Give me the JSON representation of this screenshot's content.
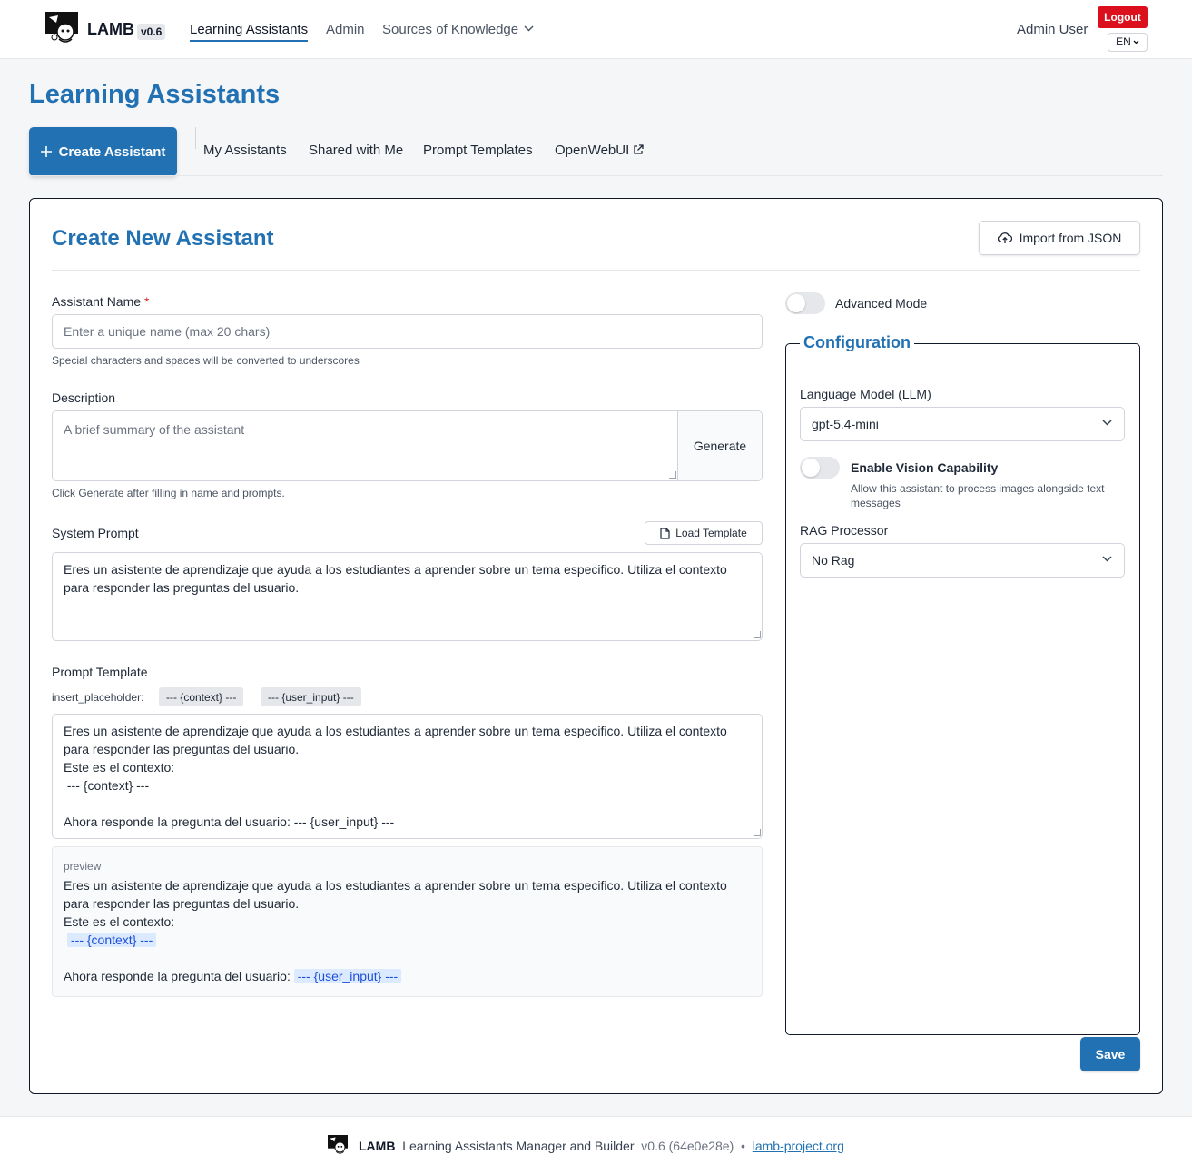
{
  "header": {
    "brand": "LAMB",
    "version": "v0.6",
    "nav": [
      {
        "label": "Learning Assistants",
        "active": true
      },
      {
        "label": "Admin",
        "active": false
      },
      {
        "label": "Sources of Knowledge",
        "active": false
      }
    ],
    "user_name": "Admin User",
    "logout_label": "Logout",
    "language": "EN"
  },
  "page": {
    "title": "Learning Assistants",
    "create_button": "Create Assistant",
    "tabs": [
      "My Assistants",
      "Shared with Me",
      "Prompt Templates",
      "OpenWebUI"
    ]
  },
  "form": {
    "title": "Create New Assistant",
    "import_button": "Import from JSON",
    "name": {
      "label": "Assistant Name",
      "required_mark": "*",
      "placeholder": "Enter a unique name (max 20 chars)",
      "value": "",
      "hint": "Special characters and spaces will be converted to underscores"
    },
    "description": {
      "label": "Description",
      "placeholder": "A brief summary of the assistant",
      "value": "",
      "generate_button": "Generate",
      "hint": "Click Generate after filling in name and prompts."
    },
    "system_prompt": {
      "label": "System Prompt",
      "load_template_button": "Load Template",
      "value": "Eres un asistente de aprendizaje que ayuda a los estudiantes a aprender sobre un tema especifico. Utiliza el contexto\npara responder las preguntas del usuario."
    },
    "prompt_template": {
      "label": "Prompt Template",
      "placeholder_label": "insert_placeholder:",
      "placeholders": [
        "--- {context} ---",
        "--- {user_input} ---"
      ],
      "value": "Eres un asistente de aprendizaje que ayuda a los estudiantes a aprender sobre un tema especifico. Utiliza el contexto\npara responder las preguntas del usuario.\nEste es el contexto:\n --- {context} ---\n\nAhora responde la pregunta del usuario: --- {user_input} ---"
    },
    "preview": {
      "label": "preview",
      "line1": "Eres un asistente de aprendizaje que ayuda a los estudiantes a aprender sobre un tema especifico. Utiliza el contexto",
      "line2": "para responder las preguntas del usuario.",
      "line3": "Este es el contexto:",
      "context_token": "--- {context} ---",
      "line5_prefix": "Ahora responde la pregunta del usuario:",
      "user_input_token": "--- {user_input} ---"
    },
    "advanced_mode": {
      "label": "Advanced Mode",
      "enabled": false
    },
    "configuration": {
      "legend": "Configuration",
      "llm_label": "Language Model (LLM)",
      "llm_value": "gpt-5.4-mini",
      "vision": {
        "label": "Enable Vision Capability",
        "enabled": false,
        "hint": "Allow this assistant to process images alongside text messages"
      },
      "rag_label": "RAG Processor",
      "rag_value": "No Rag"
    },
    "save_button": "Save"
  },
  "footer": {
    "brand": "LAMB",
    "tagline": "Learning Assistants Manager and Builder",
    "version": "v0.6 (64e0e28e)",
    "separator": "•",
    "link": "lamb-project.org"
  },
  "colors": {
    "primary": "#2271b3",
    "logout": "#dc0f1c",
    "highlight_bg": "#dbeafe",
    "highlight_text": "#1d4ed8"
  },
  "icons": [
    "lamb-logo-icon",
    "chevron-down-icon",
    "plus-icon",
    "external-link-icon",
    "cloud-upload-icon",
    "file-icon"
  ]
}
